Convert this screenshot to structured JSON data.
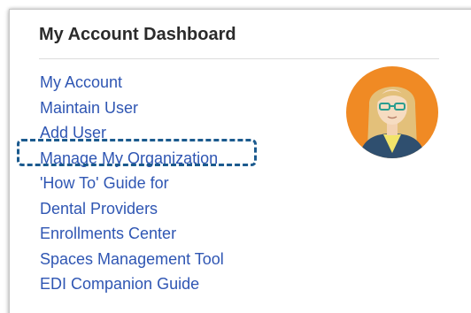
{
  "dashboard": {
    "title": "My Account Dashboard",
    "links": [
      {
        "label": "My Account"
      },
      {
        "label": "Maintain User"
      },
      {
        "label": "Add User"
      },
      {
        "label": "Manage My Organization",
        "highlighted": true
      },
      {
        "label": "'How To' Guide for"
      },
      {
        "label": "Dental Providers"
      },
      {
        "label": "Enrollments Center"
      },
      {
        "label": "Spaces Management Tool"
      },
      {
        "label": "EDI Companion Guide"
      }
    ],
    "avatar": {
      "icon": "user-avatar",
      "background_color": "#f08a24"
    }
  },
  "colors": {
    "link": "#2f56b3",
    "title": "#2b2b2b",
    "highlight_border": "#1b5a8e"
  }
}
